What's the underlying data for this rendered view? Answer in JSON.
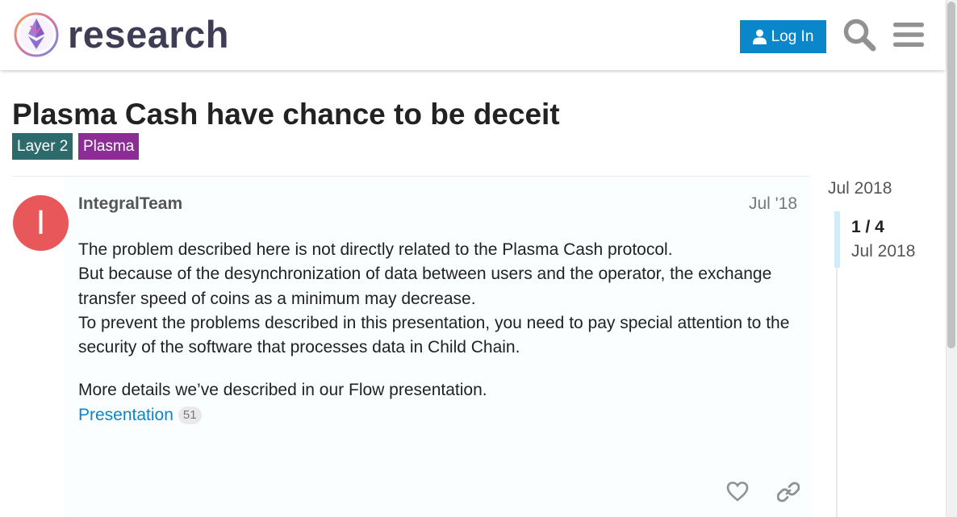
{
  "header": {
    "logo_text": "research",
    "login_label": "Log In",
    "search_icon": "search-icon",
    "menu_icon": "hamburger-menu-icon"
  },
  "topic": {
    "title": "Plasma Cash have chance to be deceit",
    "tags": [
      {
        "label": "Layer 2",
        "color": "#2c6a6b"
      },
      {
        "label": "Plasma",
        "color": "#8c2c95"
      }
    ]
  },
  "post": {
    "avatar_letter": "I",
    "avatar_color": "#e8585a",
    "username": "IntegralTeam",
    "date": "Jul '18",
    "paragraphs": [
      "The problem described here is not directly related to the Plasma Cash protocol.",
      "But because of the desynchronization of data between users and the operator, the exchange transfer speed of coins as a minimum may decrease.",
      "To prevent the problems described in this presentation, you need to pay special attention to the security of the software that processes data in Child Chain.",
      "More details we’ve described in our Flow presentation."
    ],
    "link_label": "Presentation",
    "link_clicks": "51"
  },
  "timeline": {
    "start_date": "Jul 2018",
    "position": "1 / 4",
    "current_date": "Jul 2018"
  },
  "colors": {
    "accent": "#0a86ca",
    "text": "#222222",
    "muted": "#777777"
  }
}
